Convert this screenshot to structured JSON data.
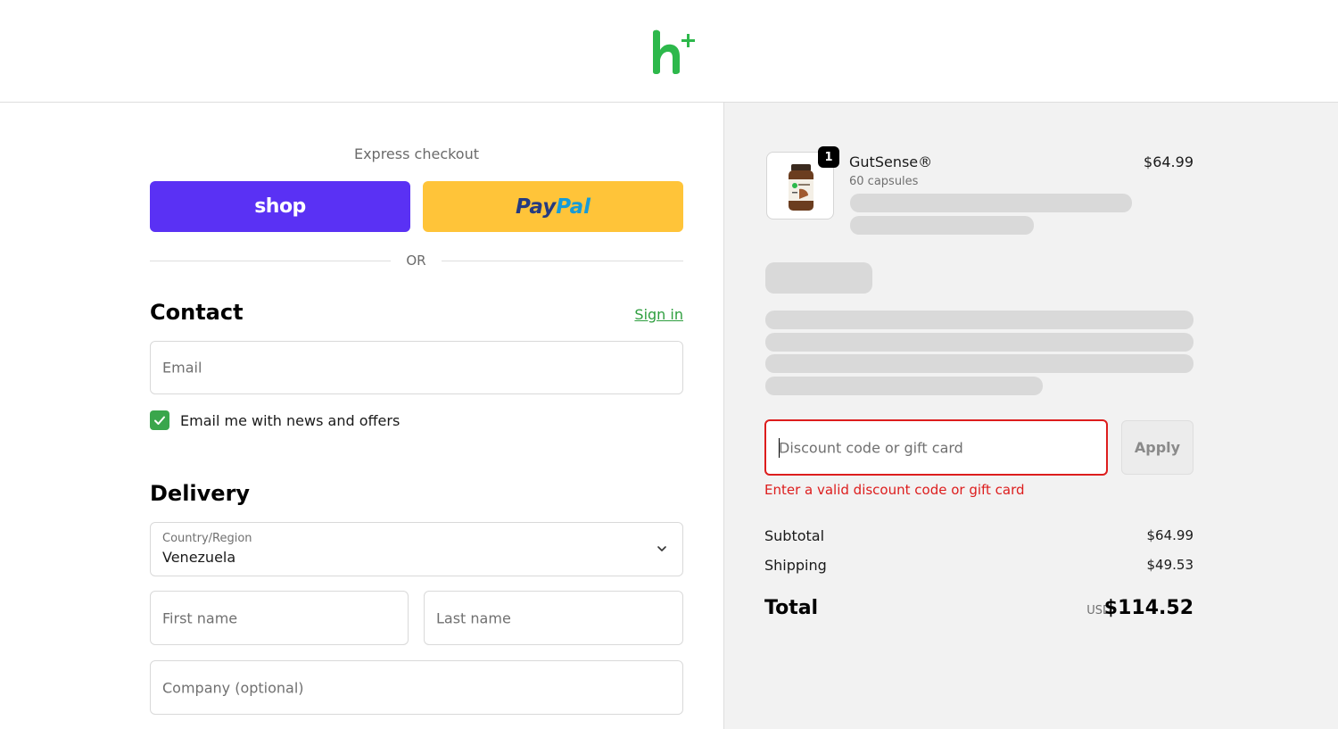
{
  "header": {
    "logo_icon": "h-plus-logo-icon",
    "brand_color": "#2db84b"
  },
  "express": {
    "title": "Express checkout",
    "shop_label": "shop",
    "paypal_label_pay": "Pay",
    "paypal_label_pal": "Pal",
    "shop_color": "#5a31f4",
    "paypal_color": "#ffc439"
  },
  "divider": {
    "or_label": "OR"
  },
  "contact": {
    "title": "Contact",
    "sign_in": "Sign in",
    "email_placeholder": "Email",
    "newsletter_label": "Email me with news and offers",
    "newsletter_checked": true
  },
  "delivery": {
    "title": "Delivery",
    "country_label": "Country/Region",
    "country_value": "Venezuela",
    "first_name_placeholder": "First name",
    "last_name_placeholder": "Last name",
    "company_placeholder": "Company (optional)"
  },
  "order": {
    "item": {
      "name": "GutSense®",
      "variant": "60 capsules",
      "price": "$64.99",
      "quantity": "1"
    },
    "discount": {
      "placeholder": "Discount code or gift card",
      "apply_label": "Apply",
      "error": "Enter a valid discount code or gift card",
      "error_color": "#dd1d1d"
    },
    "summary": {
      "subtotal_label": "Subtotal",
      "subtotal_value": "$64.99",
      "shipping_label": "Shipping",
      "shipping_value": "$49.53",
      "total_label": "Total",
      "currency": "USD",
      "total_value": "$114.52"
    }
  }
}
